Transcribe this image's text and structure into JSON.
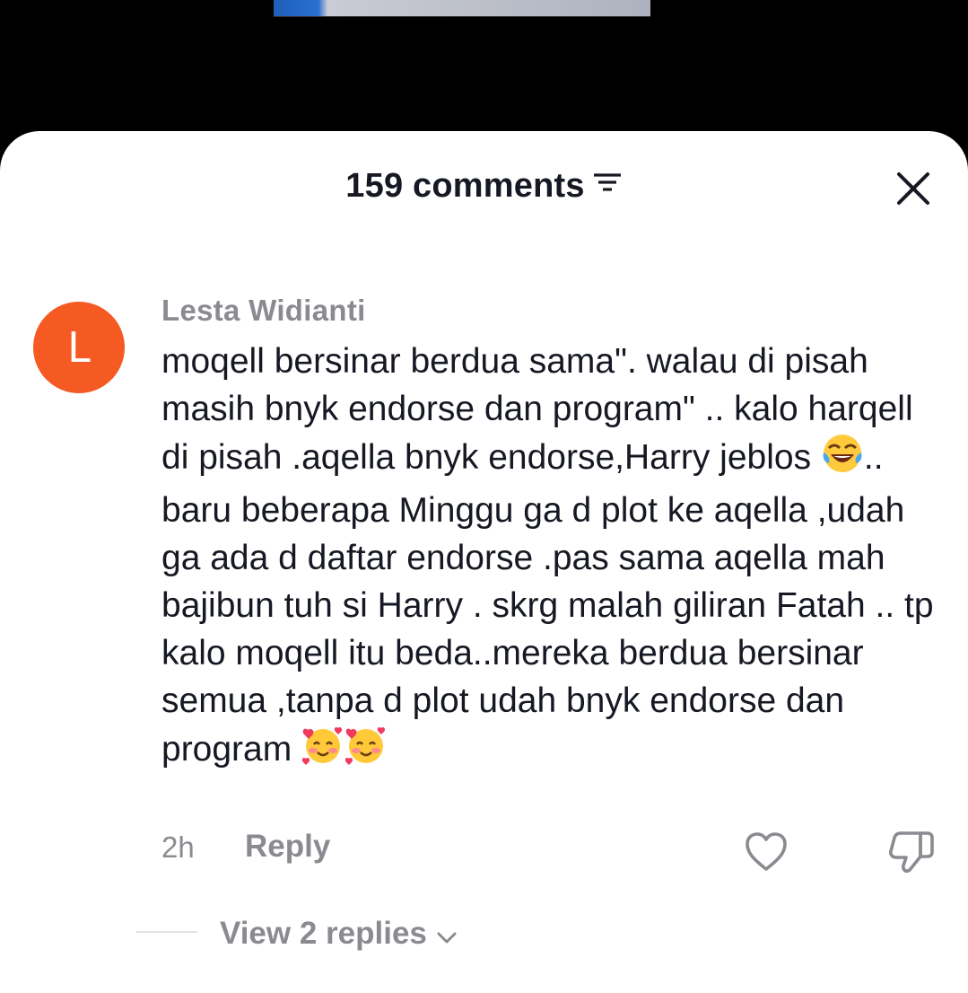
{
  "header": {
    "title": "159 comments",
    "filter_icon": "filter-icon",
    "close_icon": "close-icon"
  },
  "comment": {
    "avatar_letter": "L",
    "avatar_color": "#f55a23",
    "username": "Lesta Widianti",
    "text_part1": "moqell bersinar berdua sama\". walau di pisah masih bnyk endorse dan program\" .. kalo harqell di pisah .aqella bnyk endorse,Harry jeblos ",
    "emoji1": "face-with-tears-of-joy",
    "text_part2": ".. baru beberapa Minggu ga d plot ke aqella ,udah ga ada d daftar endorse .pas sama aqella mah bajibun tuh si Harry . skrg malah giliran Fatah .. tp kalo moqell itu beda..mereka berdua bersinar semua ,tanpa d plot udah bnyk endorse dan program ",
    "emoji2": "smiling-face-with-hearts",
    "emoji3": "smiling-face-with-hearts",
    "time": "2h",
    "reply_label": "Reply",
    "like_icon": "heart-icon",
    "dislike_icon": "thumbs-down-icon"
  },
  "replies": {
    "view_label": "View 2 replies",
    "chevron_icon": "chevron-down-icon"
  }
}
